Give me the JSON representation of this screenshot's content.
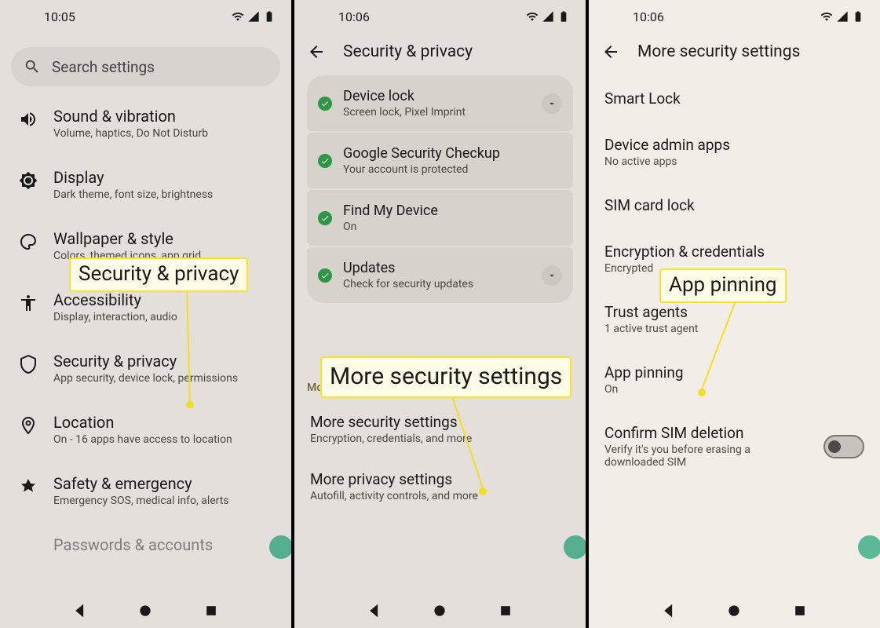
{
  "screen1": {
    "time": "10:05",
    "search_placeholder": "Search settings",
    "items": [
      {
        "title": "Sound & vibration",
        "sub": "Volume, haptics, Do Not Disturb"
      },
      {
        "title": "Display",
        "sub": "Dark theme, font size, brightness"
      },
      {
        "title": "Wallpaper & style",
        "sub": "Colors, themed icons, app grid"
      },
      {
        "title": "Accessibility",
        "sub": "Display, interaction, audio"
      },
      {
        "title": "Security & privacy",
        "sub": "App security, device lock, permissions"
      },
      {
        "title": "Location",
        "sub": "On - 16 apps have access to location"
      },
      {
        "title": "Safety & emergency",
        "sub": "Emergency SOS, medical info, alerts"
      },
      {
        "title": "Passwords & accounts",
        "sub": ""
      }
    ]
  },
  "screen2": {
    "time": "10:06",
    "title": "Security & privacy",
    "cards": [
      {
        "title": "Device lock",
        "sub": "Screen lock, Pixel Imprint",
        "expandable": true
      },
      {
        "title": "Google Security Checkup",
        "sub": "Your account is protected",
        "expandable": false
      },
      {
        "title": "Find My Device",
        "sub": "On",
        "expandable": false
      },
      {
        "title": "Updates",
        "sub": "Check for security updates",
        "expandable": true
      }
    ],
    "section_header": "More settings",
    "more": [
      {
        "title": "More security settings",
        "sub": "Encryption, credentials, and more"
      },
      {
        "title": "More privacy settings",
        "sub": "Autofill, activity controls, and more"
      }
    ]
  },
  "screen3": {
    "time": "10:06",
    "title": "More security settings",
    "rows": [
      {
        "title": "Smart Lock",
        "sub": ""
      },
      {
        "title": "Device admin apps",
        "sub": "No active apps"
      },
      {
        "title": "SIM card lock",
        "sub": ""
      },
      {
        "title": "Encryption & credentials",
        "sub": "Encrypted"
      },
      {
        "title": "Trust agents",
        "sub": "1 active trust agent"
      },
      {
        "title": "App pinning",
        "sub": "On"
      },
      {
        "title": "Confirm SIM deletion",
        "sub": "Verify it's you before erasing a downloaded SIM",
        "toggle": true
      }
    ]
  },
  "callouts": {
    "c1": "Security & privacy",
    "c2": "More security settings",
    "c3": "App pinning"
  }
}
